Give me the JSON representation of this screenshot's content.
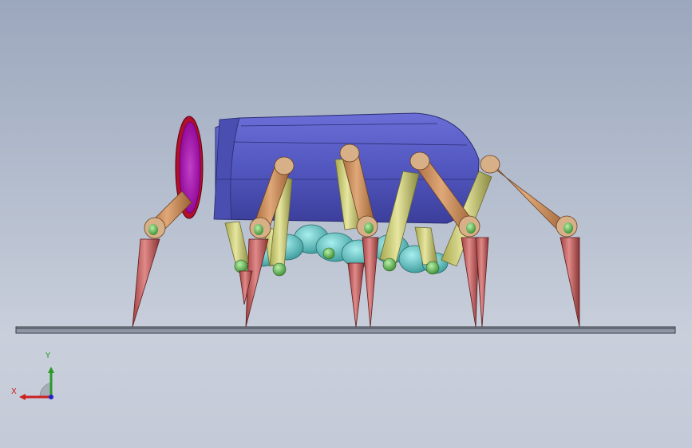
{
  "viewport": {
    "background_top": "#9ba7bd",
    "background_bottom": "#c9cfdb"
  },
  "model": {
    "name_icon": "spider-robot-model",
    "colors": {
      "body": "#5b5fc4",
      "body_shadow": "#3f42a0",
      "opening_rim": "#b0102a",
      "opening_inner": "#a010a8",
      "upper_leg": "#c98a5a",
      "middle_leg": "#cfcf7a",
      "foot": "#c85a5a",
      "joint": "#5cb84c",
      "underbody": "#5ec2c2"
    }
  },
  "triad": {
    "x_label": "X",
    "y_label": "Y",
    "x_color": "#cc2020",
    "y_color": "#2a9a2a",
    "z_color": "#2020cc"
  }
}
